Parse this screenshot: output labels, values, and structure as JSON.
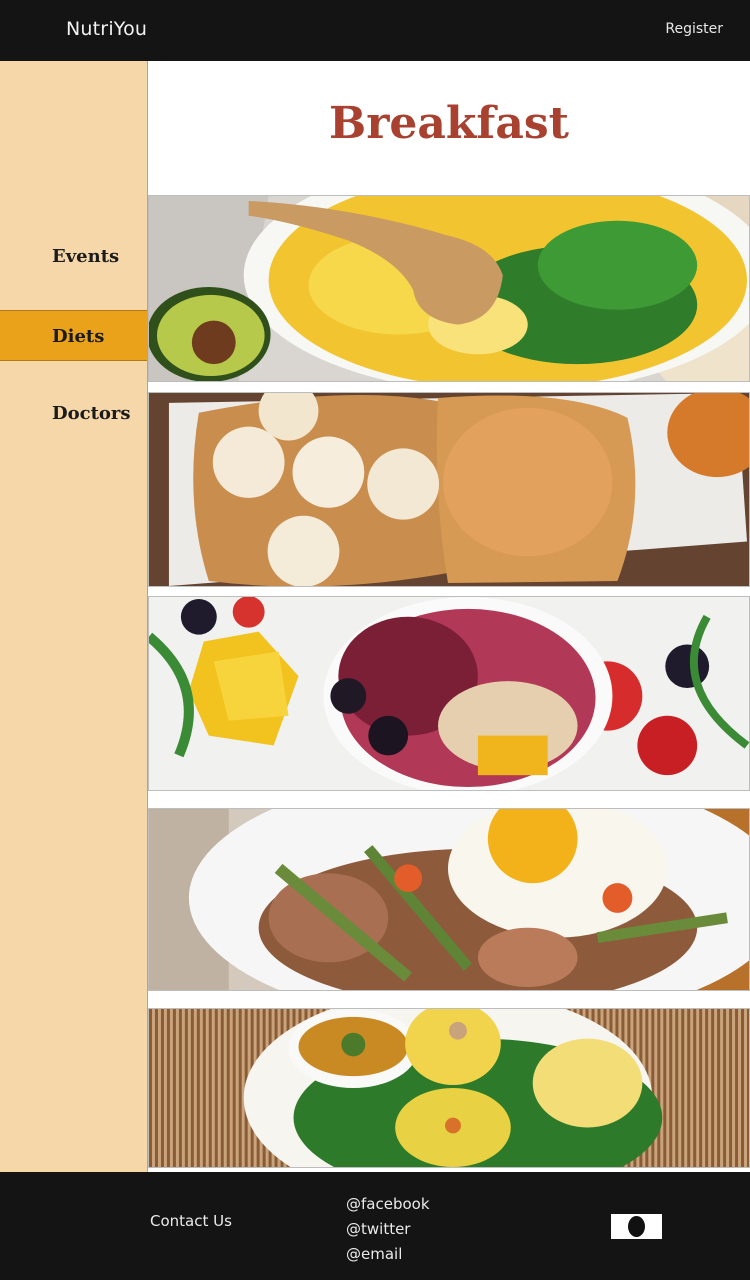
{
  "header": {
    "brand": "NutriYou",
    "register_label": "Register"
  },
  "sidebar": {
    "items": [
      {
        "label": "Events",
        "active": false
      },
      {
        "label": "Diets",
        "active": true
      },
      {
        "label": "Doctors",
        "active": false
      }
    ]
  },
  "main": {
    "title": "Breakfast",
    "photos": [
      {
        "subject": "scrambled eggs with herbs, avocado and flatbread"
      },
      {
        "subject": "peanut butter toast with banana slices and flax seeds"
      },
      {
        "subject": "smoothie bowl with berries, mango and almonds"
      },
      {
        "subject": "fried egg with roasted potatoes and asparagus"
      },
      {
        "subject": "indian breakfast plate with dal and rice on banana leaf"
      }
    ]
  },
  "footer": {
    "contact_label": "Contact Us",
    "social": [
      "@facebook",
      "@twitter",
      "@email"
    ],
    "logo_icon": "oval-logo-icon"
  },
  "colors": {
    "accent": "#e9a219",
    "sidebar": "#f5d7aa",
    "title": "#a8412f",
    "bars": "#141414"
  }
}
